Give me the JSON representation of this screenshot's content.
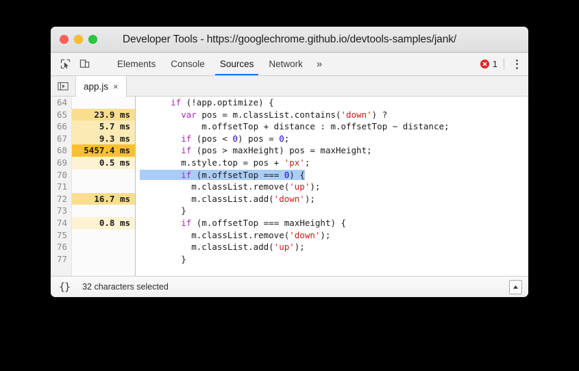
{
  "window": {
    "title": "Developer Tools - https://googlechrome.github.io/devtools-samples/jank/",
    "traffic_lights": {
      "close": "close-button",
      "minimize": "minimize-button",
      "maximize": "maximize-button"
    }
  },
  "toolbar": {
    "inspect_icon": "inspect-element-icon",
    "device_icon": "device-toolbar-icon",
    "tabs": [
      {
        "label": "Elements",
        "active": false
      },
      {
        "label": "Console",
        "active": false
      },
      {
        "label": "Sources",
        "active": true
      },
      {
        "label": "Network",
        "active": false
      }
    ],
    "more_tabs_label": "»",
    "error_count": "1",
    "error_icon": "error-circle-icon",
    "menu_icon": "more-options-icon"
  },
  "tabstrip": {
    "nav_toggle_icon": "show-navigator-icon",
    "files": [
      {
        "name": "app.js",
        "close": "×"
      }
    ]
  },
  "editor": {
    "accent_selection": "#aacdf7",
    "lines": [
      {
        "num": "64",
        "time": "",
        "heat": "none",
        "code": "      if (!app.optimize) {"
      },
      {
        "num": "65",
        "time": "23.9 ms",
        "heat": "med",
        "code": "        var pos = m.classList.contains('down') ?"
      },
      {
        "num": "66",
        "time": "5.7 ms",
        "heat": "low",
        "code": "            m.offsetTop + distance : m.offsetTop − distance;"
      },
      {
        "num": "67",
        "time": "9.3 ms",
        "heat": "low",
        "code": "        if (pos < 0) pos = 0;"
      },
      {
        "num": "68",
        "time": "5457.4 ms",
        "heat": "high",
        "code": "        if (pos > maxHeight) pos = maxHeight;"
      },
      {
        "num": "69",
        "time": "0.5 ms",
        "heat": "faint",
        "code": "        m.style.top = pos + 'px';"
      },
      {
        "num": "70",
        "time": "",
        "heat": "none",
        "code": "        if (m.offsetTop === 0) {"
      },
      {
        "num": "71",
        "time": "",
        "heat": "none",
        "code": "          m.classList.remove('up');"
      },
      {
        "num": "72",
        "time": "16.7 ms",
        "heat": "med",
        "code": "          m.classList.add('down');"
      },
      {
        "num": "73",
        "time": "",
        "heat": "none",
        "code": "        }"
      },
      {
        "num": "74",
        "time": "0.8 ms",
        "heat": "faint",
        "code": "        if (m.offsetTop === maxHeight) {"
      },
      {
        "num": "75",
        "time": "",
        "heat": "none",
        "code": "          m.classList.remove('down');"
      },
      {
        "num": "76",
        "time": "",
        "heat": "none",
        "code": "          m.classList.add('up');"
      },
      {
        "num": "77",
        "time": "",
        "heat": "none",
        "code": "        }"
      }
    ],
    "selected_line_index": 6,
    "selected_text": "        if (m.offsetTop === 0) {"
  },
  "statusbar": {
    "pretty_print_icon": "{}",
    "message": "32 characters selected",
    "scroll_icon": "scroll-to-top-icon"
  }
}
